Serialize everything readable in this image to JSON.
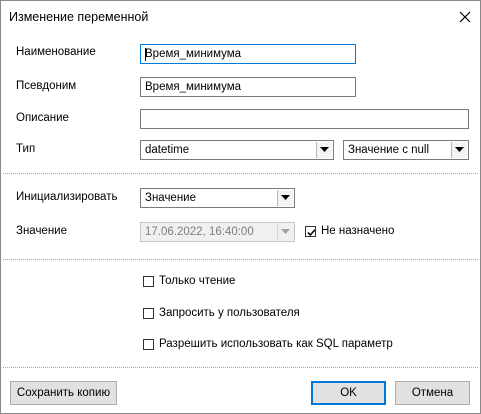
{
  "window": {
    "title": "Изменение переменной"
  },
  "form": {
    "name_label": "Наименование",
    "name_value": "Время_минимума",
    "alias_label": "Псевдоним",
    "alias_value": "Время_минимума",
    "description_label": "Описание",
    "description_value": "",
    "type_label": "Тип",
    "type_value": "datetime",
    "null_value": "Значение с null",
    "init_label": "Инициализировать",
    "init_value": "Значение",
    "value_label": "Значение",
    "value_value": "17.06.2022, 16:40:00",
    "not_assigned_label": "Не назначено",
    "not_assigned_checked": true
  },
  "options": {
    "readonly_label": "Только чтение",
    "readonly_checked": false,
    "ask_user_label": "Запросить у пользователя",
    "ask_user_checked": false,
    "allow_sql_label": "Разрешить использовать как SQL параметр",
    "allow_sql_checked": false
  },
  "buttons": {
    "save_copy": "Сохранить копию",
    "ok": "OK",
    "cancel": "Отмена"
  },
  "icons": {
    "close": "close-icon",
    "dropdown": "chevron-down-icon",
    "check": "check-icon"
  },
  "colors": {
    "focus_border": "#0078d7",
    "button_face": "#e1e1e1"
  }
}
